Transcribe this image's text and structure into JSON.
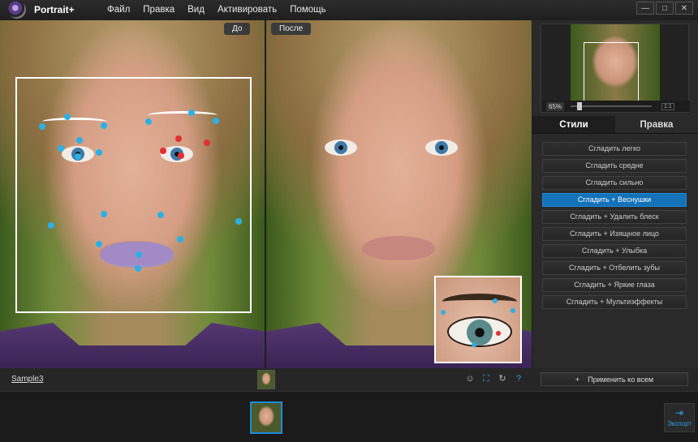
{
  "app": {
    "name": "Portrait+",
    "menu": [
      "Файл",
      "Правка",
      "Вид",
      "Активировать",
      "Помощь"
    ],
    "window_controls": {
      "minimize": "—",
      "maximize": "□",
      "close": "✕"
    }
  },
  "view": {
    "before_label": "До",
    "after_label": "После"
  },
  "navigator": {
    "zoom": "65%",
    "zoom_fraction": 0.08,
    "fit_label": "1:1"
  },
  "tabs": [
    "Стили",
    "Правка"
  ],
  "active_tab": "Стили",
  "styles": [
    "Сгладить легко",
    "Сгладить средне",
    "Сгладить сильно",
    "Сгладить + Веснушки",
    "Сгладить + Удалить блеск",
    "Сгладить + Изящное лицо",
    "Сгладить + Улыбка",
    "Сгладить + Отбелить зубы",
    "Сгладить + Яркие глаза",
    "Сгладить + Мультиэффекты"
  ],
  "selected_style": "Сгладить + Веснушки",
  "bottom": {
    "file_name": "Sample3",
    "apply_all_label": "Применить ко всем",
    "apply_all_icon": "+",
    "export_label": "Экспорт",
    "tool_icons": [
      "face-detect-icon",
      "face-select-icon",
      "rotate-icon",
      "help-icon"
    ],
    "help_text": "?"
  },
  "colors": {
    "accent": "#1372b8",
    "marker": "#2bb0e6",
    "marker_alert": "#e03030"
  }
}
